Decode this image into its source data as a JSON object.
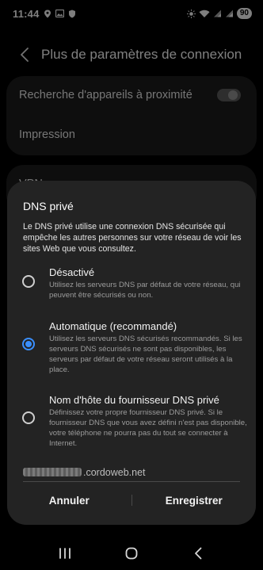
{
  "status_bar": {
    "time": "11:44",
    "battery": "90",
    "icons": [
      "location-pin-icon",
      "image-icon",
      "shield-icon",
      "brightness-icon",
      "wifi-icon",
      "signal-icon",
      "signal-icon"
    ]
  },
  "header": {
    "title": "Plus de paramètres de connexion",
    "back_icon": "chevron-left-icon"
  },
  "settings": {
    "items": [
      {
        "label": "Recherche d'appareils à proximité",
        "toggle": false
      },
      {
        "label": "Impression"
      },
      {
        "label": "VPN"
      }
    ]
  },
  "dialog": {
    "title": "DNS privé",
    "description": "Le DNS privé utilise une connexion DNS sécurisée qui empêche les autres personnes sur votre réseau de voir les sites Web que vous consultez.",
    "options": [
      {
        "title": "Désactivé",
        "description": "Utilisez les serveurs DNS par défaut de votre réseau, qui peuvent être sécurisés ou non.",
        "selected": false
      },
      {
        "title": "Automatique (recommandé)",
        "description": "Utilisez les serveurs DNS sécurisés recommandés. Si les serveurs DNS sécurisés ne sont pas disponibles, les serveurs par défaut de votre réseau seront utilisés à la place.",
        "selected": true
      },
      {
        "title": "Nom d'hôte du fournisseur DNS privé",
        "description": "Définissez votre propre fournisseur DNS privé. Si le fournisseur DNS que vous avez défini n'est pas disponible, votre téléphone ne pourra pas du tout se connecter à Internet.",
        "selected": false
      }
    ],
    "hostname_visible": ".cordoweb.net",
    "cancel_label": "Annuler",
    "save_label": "Enregistrer"
  },
  "colors": {
    "accent": "#3a8fff",
    "dialog_bg": "#232323",
    "card_bg": "#1b1b1b"
  },
  "nav_bar": {
    "icons": [
      "recent-apps-icon",
      "home-icon",
      "back-icon"
    ]
  }
}
